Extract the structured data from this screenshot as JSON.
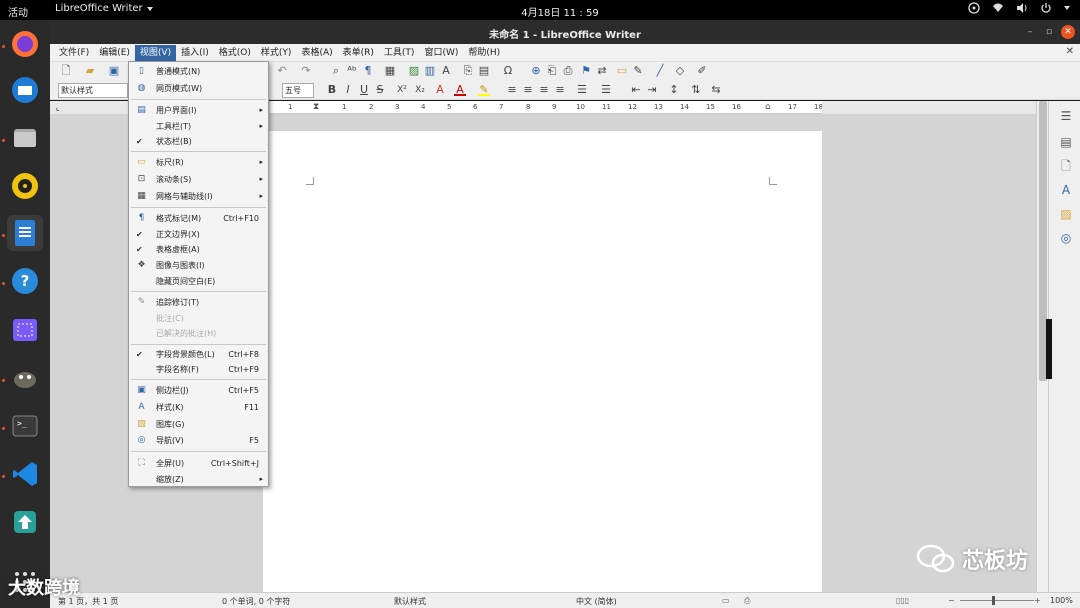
{
  "topbar": {
    "activities": "活动",
    "app": "LibreOffice Writer",
    "clock": "4月18日  11 : 59"
  },
  "window": {
    "title": "未命名 1 - LibreOffice Writer"
  },
  "menubar": {
    "items": [
      "文件(F)",
      "编辑(E)",
      "视图(V)",
      "插入(I)",
      "格式(O)",
      "样式(Y)",
      "表格(A)",
      "表单(R)",
      "工具(T)",
      "窗口(W)",
      "帮助(H)"
    ]
  },
  "toolbar": {
    "paragraph_style": "默认样式",
    "font_size": "五号",
    "bold": "B",
    "italic": "I",
    "underline": "U",
    "strike": "S",
    "superscript": "X²",
    "subscript": "X₂"
  },
  "ruler": {
    "numbers": [
      "1",
      "1",
      "2",
      "3",
      "4",
      "5",
      "6",
      "7",
      "8",
      "9",
      "10",
      "11",
      "12",
      "13",
      "14",
      "15",
      "16",
      "17",
      "18"
    ]
  },
  "view_menu": {
    "items": [
      {
        "label": "普通模式(N)",
        "icon": "normal-view-icon"
      },
      {
        "label": "网页模式(W)",
        "icon": "web-view-icon"
      },
      {
        "label": "用户界面(I)",
        "icon": "user-interface-icon",
        "submenu": true
      },
      {
        "label": "工具栏(T)",
        "submenu": true
      },
      {
        "label": "状态栏(B)",
        "checked": true
      },
      {
        "label": "标尺(R)",
        "icon": "ruler-icon",
        "submenu": true
      },
      {
        "label": "滚动条(S)",
        "icon": "scrollbar-icon",
        "submenu": true
      },
      {
        "label": "网格与辅助线(I)",
        "icon": "grid-icon",
        "submenu": true
      },
      {
        "label": "格式标记(M)",
        "icon": "formatting-marks-icon",
        "shortcut": "Ctrl+F10"
      },
      {
        "label": "正文边界(X)",
        "checked": true
      },
      {
        "label": "表格虚框(A)",
        "checked": true
      },
      {
        "label": "图像与图表(I)",
        "icon": "images-charts-icon"
      },
      {
        "label": "隐藏页间空白(E)"
      },
      {
        "label": "追踪修订(T)",
        "icon": "track-changes-icon"
      },
      {
        "label": "批注(C)",
        "disabled": true
      },
      {
        "label": "已解决的批注(H)",
        "disabled": true
      },
      {
        "label": "字段背景颜色(L)",
        "checked": true,
        "shortcut": "Ctrl+F8"
      },
      {
        "label": "字段名称(F)",
        "shortcut": "Ctrl+F9"
      },
      {
        "label": "侧边栏(J)",
        "icon": "sidebar-icon",
        "shortcut": "Ctrl+F5"
      },
      {
        "label": "样式(K)",
        "icon": "styles-icon",
        "shortcut": "F11"
      },
      {
        "label": "图库(G)",
        "icon": "gallery-icon"
      },
      {
        "label": "导航(V)",
        "icon": "navigator-icon",
        "shortcut": "F5"
      },
      {
        "label": "全屏(U)",
        "icon": "fullscreen-icon",
        "shortcut": "Ctrl+Shift+J"
      },
      {
        "label": "缩放(Z)",
        "submenu": true
      }
    ]
  },
  "statusbar": {
    "page": "第 1 页，共 1 页",
    "words": "0 个单词, 0 个字符",
    "style": "默认样式",
    "language": "中文 (简体)",
    "zoom": "100%"
  },
  "watermark": {
    "brand": "芯板坊",
    "left": "大数跨境"
  }
}
